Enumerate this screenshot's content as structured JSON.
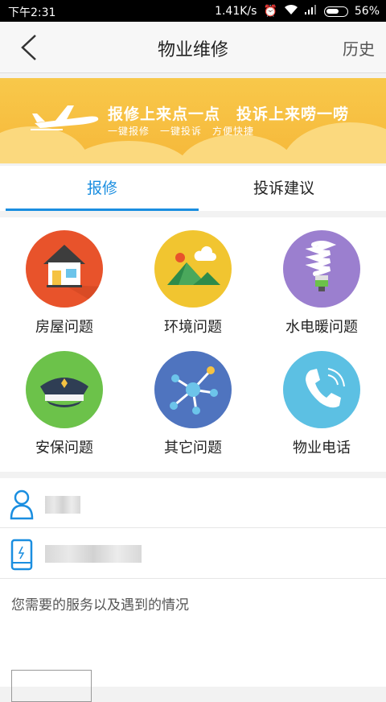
{
  "statusbar": {
    "time": "下午2:31",
    "network_speed": "1.41K/s",
    "battery": "56%"
  },
  "header": {
    "title": "物业维修",
    "history_label": "历史"
  },
  "banner": {
    "headline": "报修上来点一点　投诉上来唠一唠",
    "subline": "一键报修　一键投诉　方便快捷"
  },
  "tabs": [
    {
      "label": "报修",
      "active": true
    },
    {
      "label": "投诉建议",
      "active": false
    }
  ],
  "categories": [
    {
      "label": "房屋问题",
      "icon": "house-icon",
      "color": "#e8532b"
    },
    {
      "label": "环境问题",
      "icon": "landscape-icon",
      "color": "#f1c530"
    },
    {
      "label": "水电暖问题",
      "icon": "bulb-icon",
      "color": "#9b7fcf"
    },
    {
      "label": "安保问题",
      "icon": "police-cap-icon",
      "color": "#6cc24a"
    },
    {
      "label": "其它问题",
      "icon": "network-icon",
      "color": "#4f74bf"
    },
    {
      "label": "物业电话",
      "icon": "phone-icon",
      "color": "#5cc0e3"
    }
  ],
  "form": {
    "name_value": "",
    "phone_value": "",
    "description_placeholder": "您需要的服务以及遇到的情况"
  },
  "colors": {
    "accent": "#1a8ee0",
    "banner": "#f6b83a"
  }
}
